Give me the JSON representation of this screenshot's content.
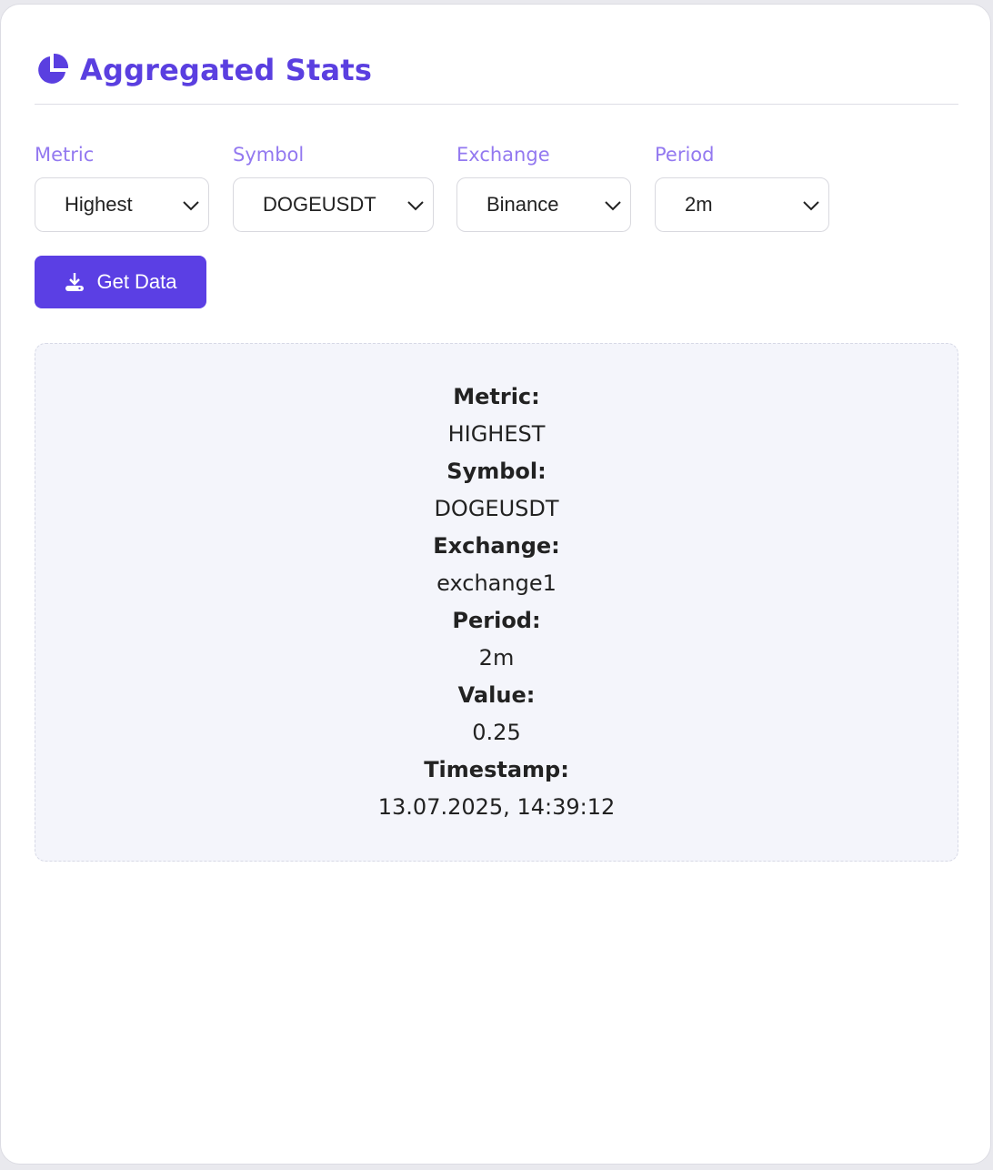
{
  "header": {
    "title": "Aggregated Stats",
    "icon": "pie-chart-icon",
    "accent_color": "#5a3fe0"
  },
  "filters": {
    "metric": {
      "label": "Metric",
      "selected": "Highest"
    },
    "symbol": {
      "label": "Symbol",
      "selected": "DOGEUSDT"
    },
    "exchange": {
      "label": "Exchange",
      "selected": "Binance"
    },
    "period": {
      "label": "Period",
      "selected": "2m"
    }
  },
  "actions": {
    "get_data_label": "Get Data",
    "get_data_icon": "download-icon",
    "button_color": "#5b3fe4"
  },
  "result": {
    "metric_label": "Metric:",
    "metric_value": "HIGHEST",
    "symbol_label": "Symbol:",
    "symbol_value": "DOGEUSDT",
    "exchange_label": "Exchange:",
    "exchange_value": "exchange1",
    "period_label": "Period:",
    "period_value": "2m",
    "value_label": "Value:",
    "value_value": "0.25",
    "timestamp_label": "Timestamp:",
    "timestamp_value": "13.07.2025, 14:39:12"
  }
}
